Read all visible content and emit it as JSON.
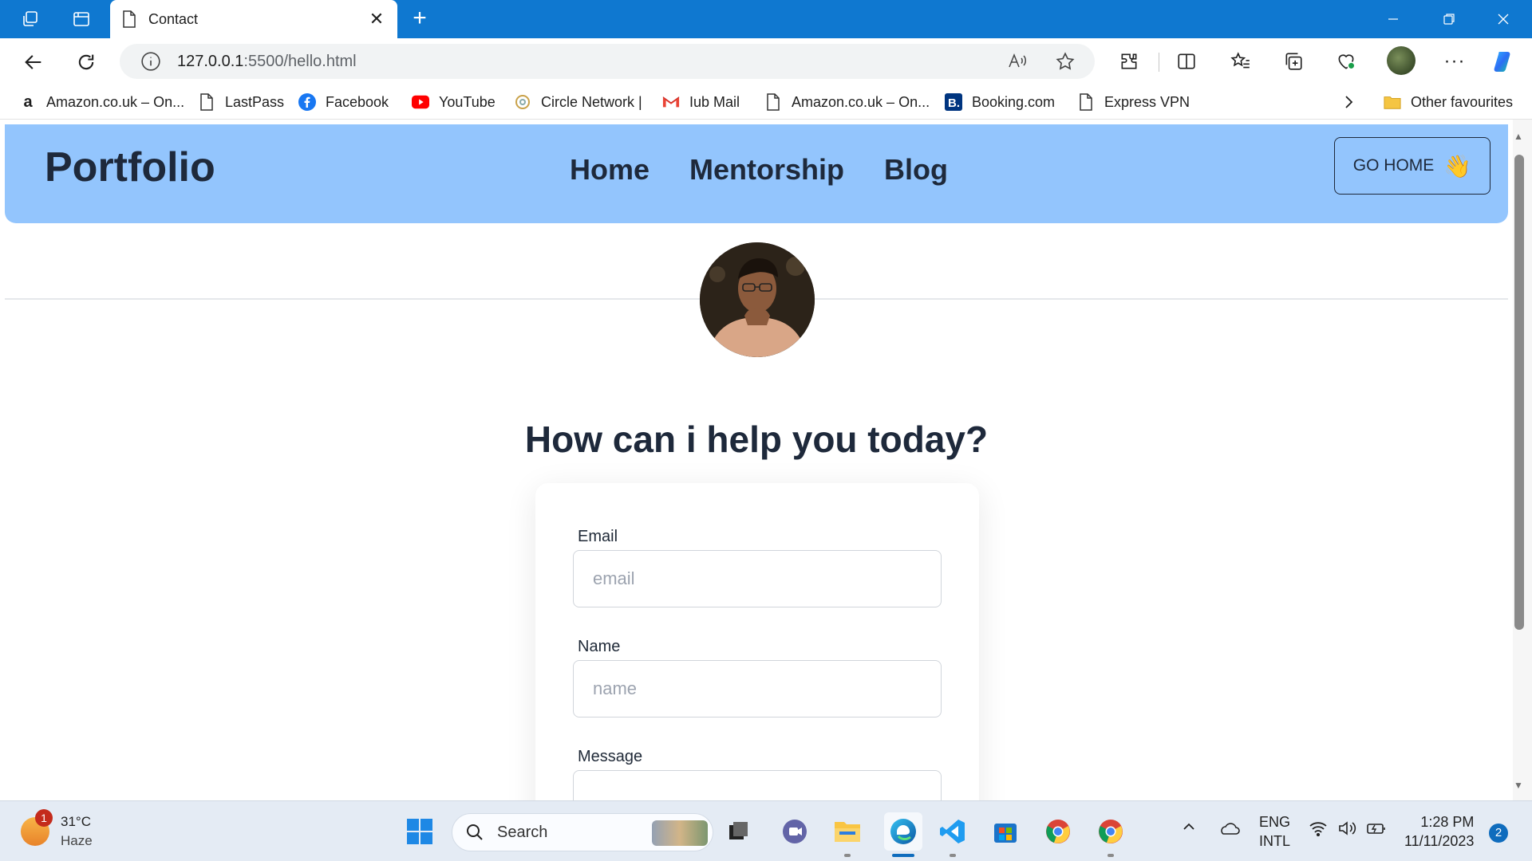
{
  "browser": {
    "tab_title": "Contact",
    "url_host": "127.0.0.1",
    "url_path": ":5500/hello.html",
    "favourites": [
      {
        "label": "Amazon.co.uk – On...",
        "icon": "amazon-icon"
      },
      {
        "label": "LastPass",
        "icon": "page-icon"
      },
      {
        "label": "Facebook",
        "icon": "facebook-icon"
      },
      {
        "label": "YouTube",
        "icon": "youtube-icon"
      },
      {
        "label": "Circle Network |",
        "icon": "circle-network-icon"
      },
      {
        "label": "Iub Mail",
        "icon": "gmail-icon"
      },
      {
        "label": "Amazon.co.uk – On...",
        "icon": "page-icon"
      },
      {
        "label": "Booking.com",
        "icon": "booking-icon"
      },
      {
        "label": "Express VPN",
        "icon": "page-icon"
      }
    ],
    "other_favourites": "Other favourites",
    "accent": "#0f78d0"
  },
  "page": {
    "brand": "Portfolio",
    "nav": [
      "Home",
      "Mentorship",
      "Blog"
    ],
    "go_home": "GO HOME",
    "go_home_emoji": "👋",
    "heading": "How can i help you today?",
    "form": {
      "email_label": "Email",
      "email_placeholder": "email",
      "name_label": "Name",
      "name_placeholder": "name",
      "message_label": "Message"
    },
    "header_color": "#93c5fd"
  },
  "taskbar": {
    "weather_temp": "31°C",
    "weather_cond": "Haze",
    "weather_badge": "1",
    "search_label": "Search",
    "lang_top": "ENG",
    "lang_bottom": "INTL",
    "time": "1:28 PM",
    "date": "11/11/2023",
    "notifications": "2"
  }
}
